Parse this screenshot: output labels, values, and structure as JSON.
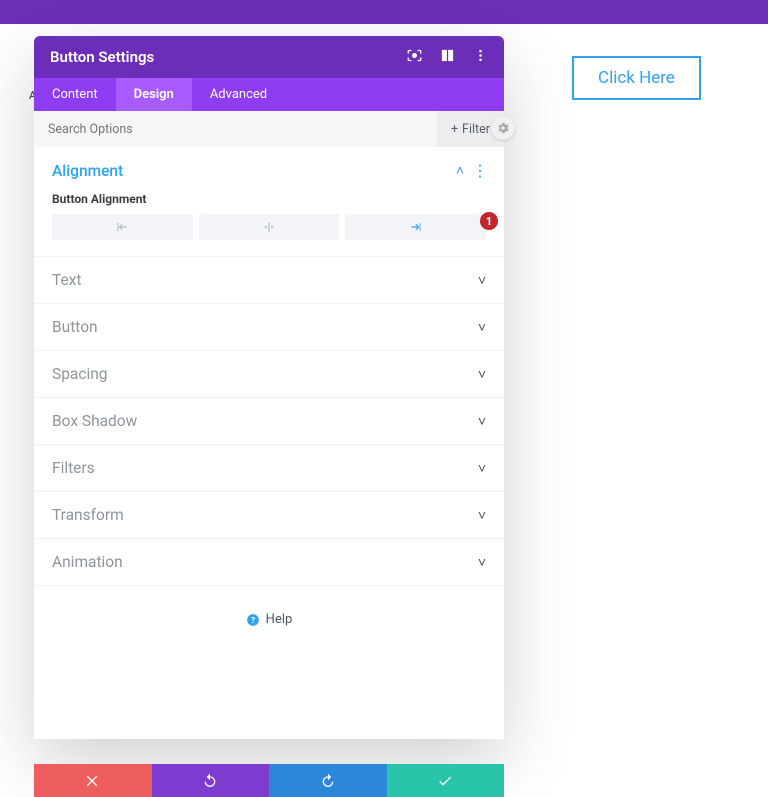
{
  "preview_button_label": "Click Here",
  "stray": "A",
  "modal": {
    "title": "Button Settings",
    "tabs": [
      {
        "label": "Content",
        "active": false
      },
      {
        "label": "Design",
        "active": true
      },
      {
        "label": "Advanced",
        "active": false
      }
    ],
    "search_placeholder": "Search Options",
    "filter_label": "Filter",
    "sections": [
      {
        "label": "Alignment",
        "open": true
      },
      {
        "label": "Text",
        "open": false
      },
      {
        "label": "Button",
        "open": false
      },
      {
        "label": "Spacing",
        "open": false
      },
      {
        "label": "Box Shadow",
        "open": false
      },
      {
        "label": "Filters",
        "open": false
      },
      {
        "label": "Transform",
        "open": false
      },
      {
        "label": "Animation",
        "open": false
      }
    ],
    "alignment": {
      "field_label": "Button Alignment",
      "options": [
        "left",
        "center",
        "right"
      ],
      "selected": "right",
      "hint_number": "1"
    },
    "help_label": "Help"
  },
  "colors": {
    "brand_purple": "#6c2eb9",
    "tab_purple": "#8e3df2",
    "accent_blue": "#2ea3f2",
    "cancel_red": "#ef5e5e",
    "redo_blue": "#2b87da",
    "save_green": "#29c4a9"
  }
}
